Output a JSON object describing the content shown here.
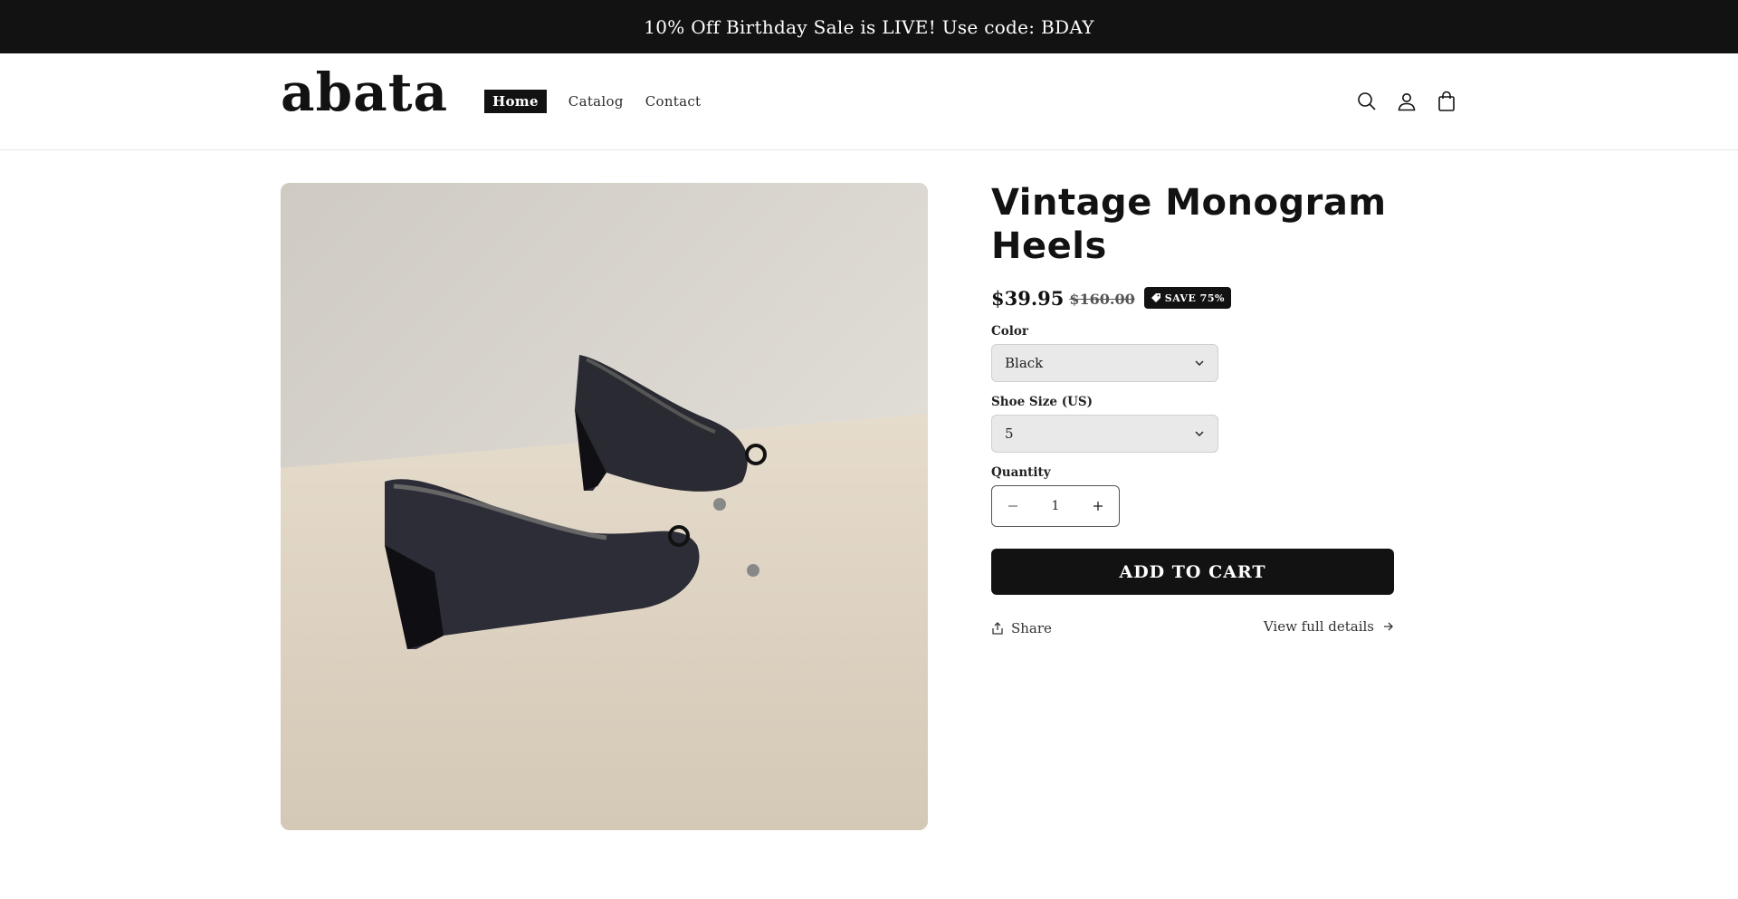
{
  "announcement": {
    "text": "10% Off Birthday Sale is LIVE! Use code: BDAY"
  },
  "header": {
    "logo": "abata",
    "nav": [
      {
        "label": "Home",
        "active": true
      },
      {
        "label": "Catalog",
        "active": false
      },
      {
        "label": "Contact",
        "active": false
      }
    ],
    "icons": [
      "search-icon",
      "account-icon",
      "cart-icon"
    ]
  },
  "product": {
    "image_icon": "product-photo",
    "title": "Vintage Monogram Heels",
    "price": "$39.95",
    "compare_price": "$160.00",
    "badge": "SAVE 75%",
    "color_label": "Color",
    "color_value": "Black",
    "size_label": "Shoe Size (US)",
    "size_value": "5",
    "quantity_label": "Quantity",
    "quantity_value": "1",
    "add_to_cart": "ADD TO CART",
    "share": "Share",
    "view_full": "View full details"
  },
  "colors": {
    "dark": "#121212",
    "select_bg": "#e9e9e9",
    "white": "#ffffff"
  }
}
